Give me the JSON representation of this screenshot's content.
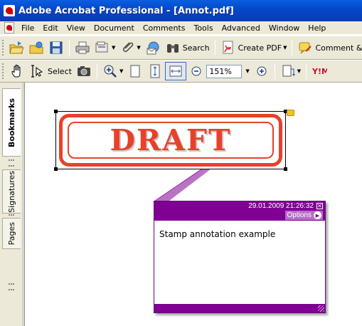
{
  "window": {
    "title": "Adobe Acrobat Professional - [Annot.pdf]"
  },
  "menu": [
    "File",
    "Edit",
    "View",
    "Document",
    "Comments",
    "Tools",
    "Advanced",
    "Window",
    "Help"
  ],
  "toolbar1": {
    "search_label": "Search",
    "create_pdf_label": "Create PDF",
    "comment_label": "Comment & M"
  },
  "toolbar2": {
    "select_label": "Select",
    "zoom_value": "151%"
  },
  "nav_tabs": [
    "Bookmarks",
    "Signatures",
    "Pages"
  ],
  "stamp": {
    "text": "DRAFT"
  },
  "popup": {
    "datetime": "29.01.2009 21:26:32",
    "options_label": "Options",
    "close_glyph": "✕",
    "content": "Stamp annotation example"
  },
  "colors": {
    "popup_accent": "#800094",
    "stamp_red": "#e8412b",
    "titlebar_blue": "#0447c7"
  }
}
